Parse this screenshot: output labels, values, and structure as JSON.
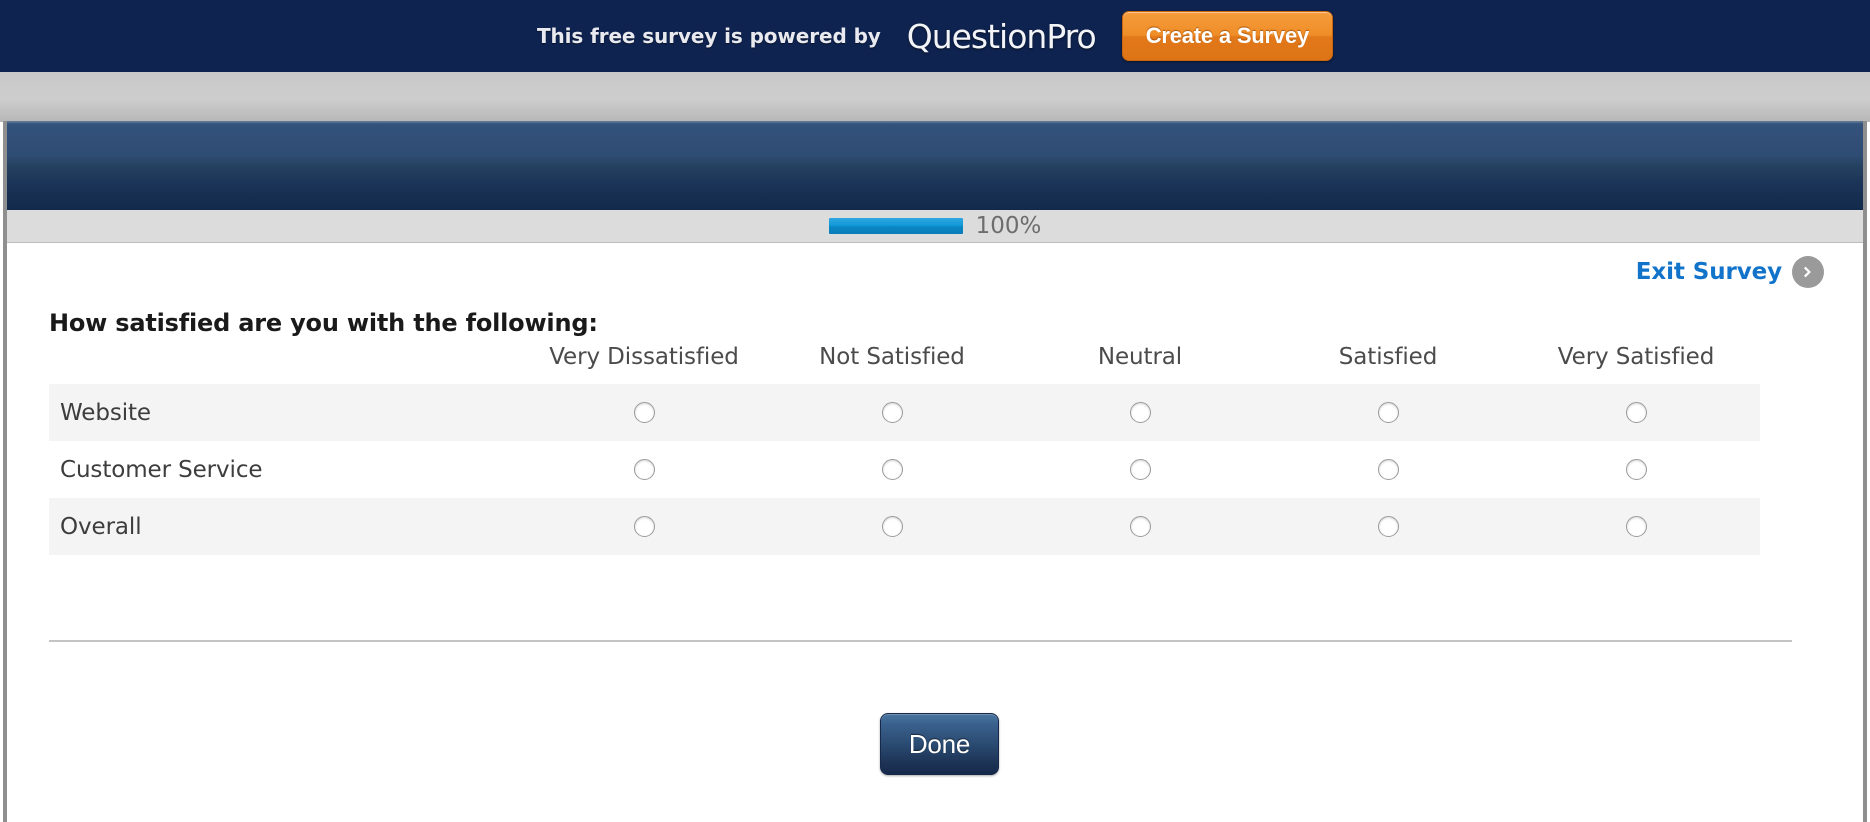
{
  "promo_banner": {
    "text": "This free survey is powered by",
    "logo": "QuestionPro",
    "cta_label": "Create a Survey",
    "background_color": "#0f2350",
    "cta_color": "#ef8e28"
  },
  "progress": {
    "percent_label": "100%",
    "percent_value": 100,
    "bar_color": "#139ad8"
  },
  "exit_survey": {
    "label": "Exit Survey",
    "icon": "chevron-right-circle-icon",
    "link_color": "#1273ca"
  },
  "question": {
    "title": "How satisfied are you with the following:",
    "columns": [
      "Very Dissatisfied",
      "Not Satisfied",
      "Neutral",
      "Satisfied",
      "Very Satisfied"
    ],
    "rows": [
      {
        "label": "Website",
        "selected": null,
        "shaded": true
      },
      {
        "label": "Customer Service",
        "selected": null,
        "shaded": false
      },
      {
        "label": "Overall",
        "selected": null,
        "shaded": true
      }
    ]
  },
  "footer": {
    "submit_label": "Done"
  }
}
